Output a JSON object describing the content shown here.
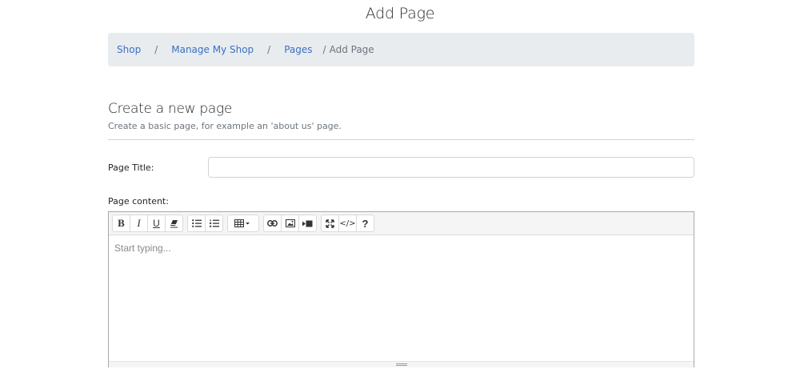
{
  "page": {
    "title": "Add Page"
  },
  "breadcrumb": {
    "items": [
      "Shop",
      "Manage My Shop",
      "Pages"
    ],
    "separator": "/",
    "current": "Add Page"
  },
  "section": {
    "heading": "Create a new page",
    "description": "Create a basic page, for example an 'about us' page."
  },
  "form": {
    "title_label": "Page Title:",
    "title_value": "",
    "content_label": "Page content:"
  },
  "editor": {
    "placeholder": "Start typing...",
    "toolbar": {
      "bold": "B",
      "italic": "I",
      "underline": "U",
      "code_view": "</>",
      "help": "?"
    },
    "icons": [
      "eraser-icon",
      "unordered-list-icon",
      "ordered-list-icon",
      "table-icon",
      "link-icon",
      "picture-icon",
      "video-icon",
      "fullscreen-icon"
    ]
  },
  "colors": {
    "link": "#3b6fc2",
    "breadcrumb_bg": "#e9ecef",
    "muted": "#6c757d"
  }
}
